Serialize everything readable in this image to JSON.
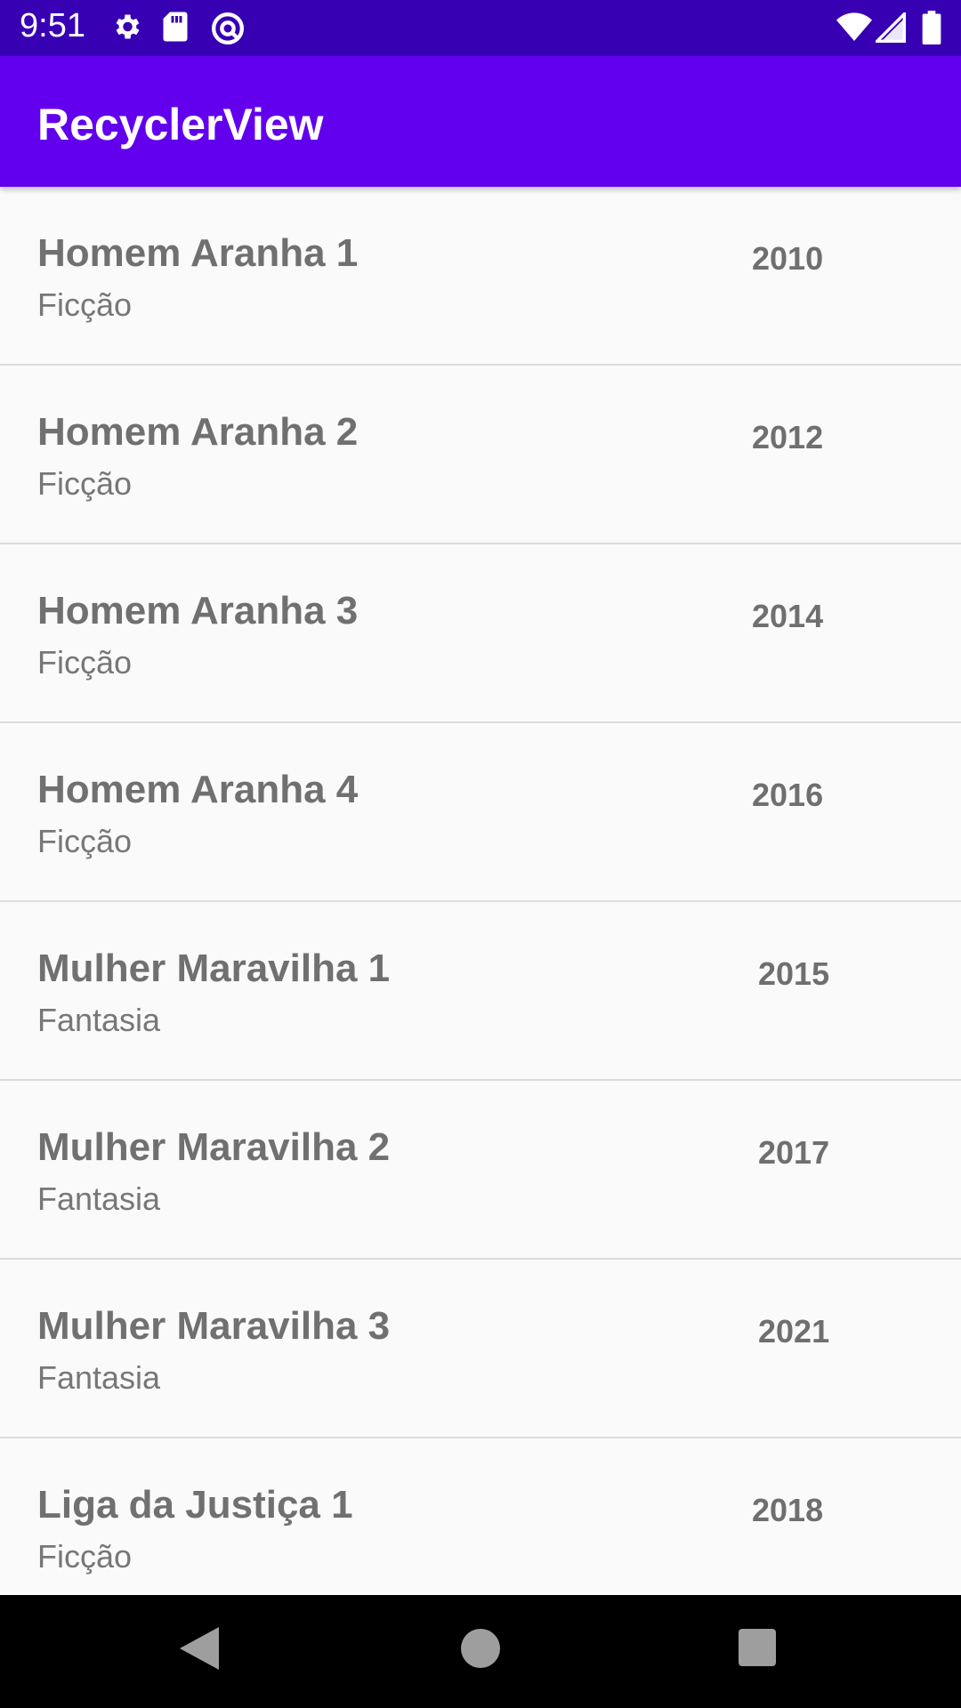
{
  "status_bar": {
    "time": "9:51",
    "icons_left": [
      "gear-icon",
      "sd-card-icon",
      "at-sign-icon"
    ],
    "icons_right": [
      "wifi-icon",
      "cell-signal-icon",
      "battery-icon"
    ],
    "color": "#3700b3"
  },
  "app_bar": {
    "title": "RecyclerView",
    "color": "#6200ee"
  },
  "movies": [
    {
      "title": "Homem Aranha 1",
      "genre": "Ficção",
      "year": "2010"
    },
    {
      "title": "Homem Aranha 2",
      "genre": "Ficção",
      "year": "2012"
    },
    {
      "title": "Homem Aranha 3",
      "genre": "Ficção",
      "year": "2014"
    },
    {
      "title": "Homem Aranha 4",
      "genre": "Ficção",
      "year": "2016"
    },
    {
      "title": "Mulher Maravilha 1",
      "genre": "Fantasia",
      "year": "2015"
    },
    {
      "title": "Mulher Maravilha 2",
      "genre": "Fantasia",
      "year": "2017"
    },
    {
      "title": "Mulher Maravilha 3",
      "genre": "Fantasia",
      "year": "2021"
    },
    {
      "title": "Liga da Justiça 1",
      "genre": "Ficção",
      "year": "2018"
    }
  ],
  "nav_bar": {
    "buttons": [
      "back-icon",
      "home-icon",
      "recents-icon"
    ]
  }
}
